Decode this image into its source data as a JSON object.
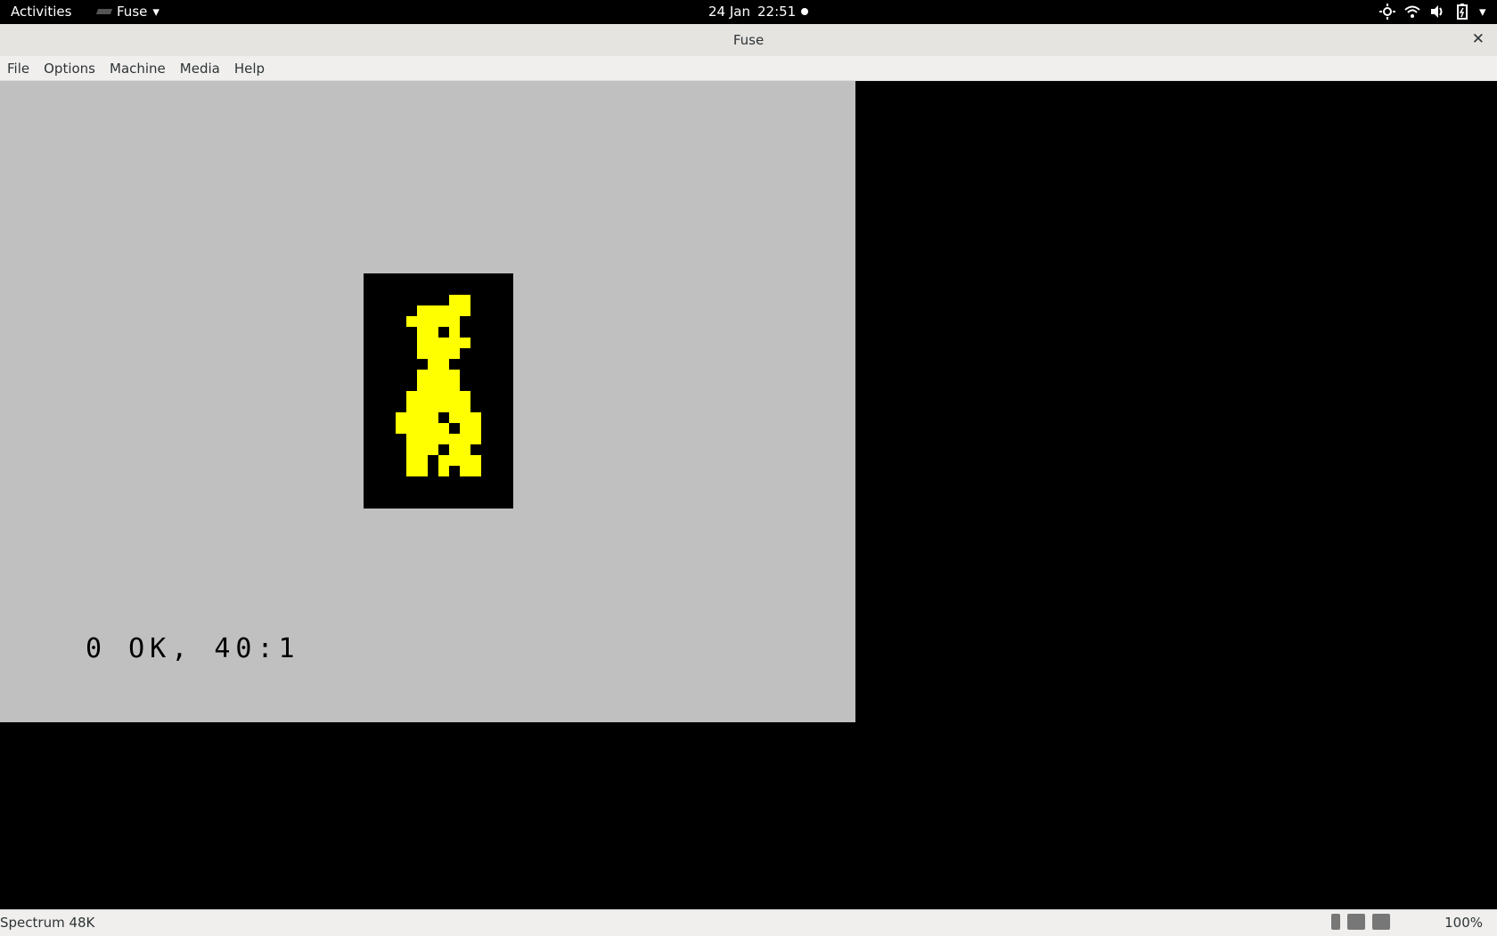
{
  "topbar": {
    "activities": "Activities",
    "app_name": "Fuse",
    "date": "24 Jan",
    "time": "22:51"
  },
  "window": {
    "title": "Fuse"
  },
  "menubar": {
    "items": [
      "File",
      "Options",
      "Machine",
      "Media",
      "Help"
    ]
  },
  "screen": {
    "status_message": "0 OK, 40:1"
  },
  "statusbar": {
    "machine": "Spectrum 48K",
    "speed": "100%"
  },
  "colors": {
    "paper": "#c0c0c0",
    "ink_sprite": "#ffff00",
    "border": "#000000"
  }
}
